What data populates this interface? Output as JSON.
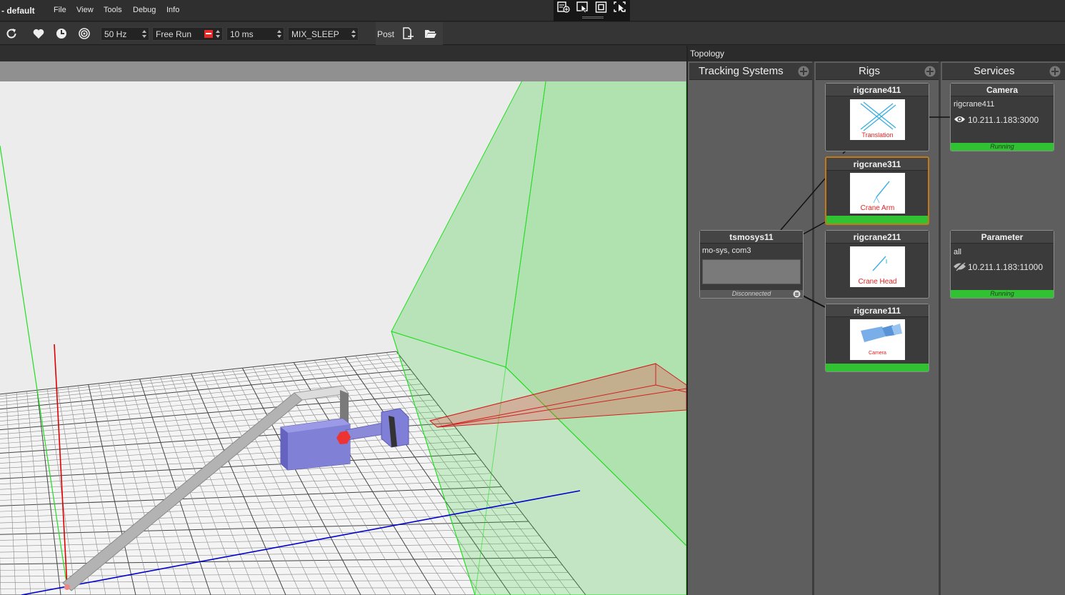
{
  "app": {
    "title": "- default"
  },
  "menu": [
    {
      "label": "File"
    },
    {
      "label": "View"
    },
    {
      "label": "Tools"
    },
    {
      "label": "Debug"
    },
    {
      "label": "Info"
    }
  ],
  "toolbar": {
    "rate": "50 Hz",
    "run_mode": "Free Run",
    "interval": "10 ms",
    "mix_mode": "MIX_SLEEP",
    "post_label": "Post"
  },
  "topology": {
    "title": "Topology",
    "columns": {
      "tracking": "Tracking Systems",
      "rigs": "Rigs",
      "services": "Services"
    },
    "tracking_system": {
      "name": "tsmosys11",
      "detail": "mo-sys,  com3",
      "status": "Disconnected"
    },
    "rigs": [
      {
        "name": "rigcrane411",
        "caption": "Translation"
      },
      {
        "name": "rigcrane311",
        "caption": "Crane Arm"
      },
      {
        "name": "rigcrane211",
        "caption": "Crane Head"
      },
      {
        "name": "rigcrane111",
        "caption": "Camera"
      }
    ],
    "services": [
      {
        "name": "Camera",
        "detail": "rigcrane411",
        "address": "10.211.1.183:3000",
        "status": "Running",
        "icon": "eye-icon"
      },
      {
        "name": "Parameter",
        "detail": "all",
        "address": "10.211.1.183:11000",
        "status": "Running",
        "icon": "eye-off-icon"
      }
    ]
  },
  "colors": {
    "status_running": "#30c232",
    "selected_border": "#c27a16",
    "axis_x": "#e00000",
    "axis_z": "#0000d0",
    "axis_y": "#00e000",
    "camera_body": "#7f7fd8"
  }
}
